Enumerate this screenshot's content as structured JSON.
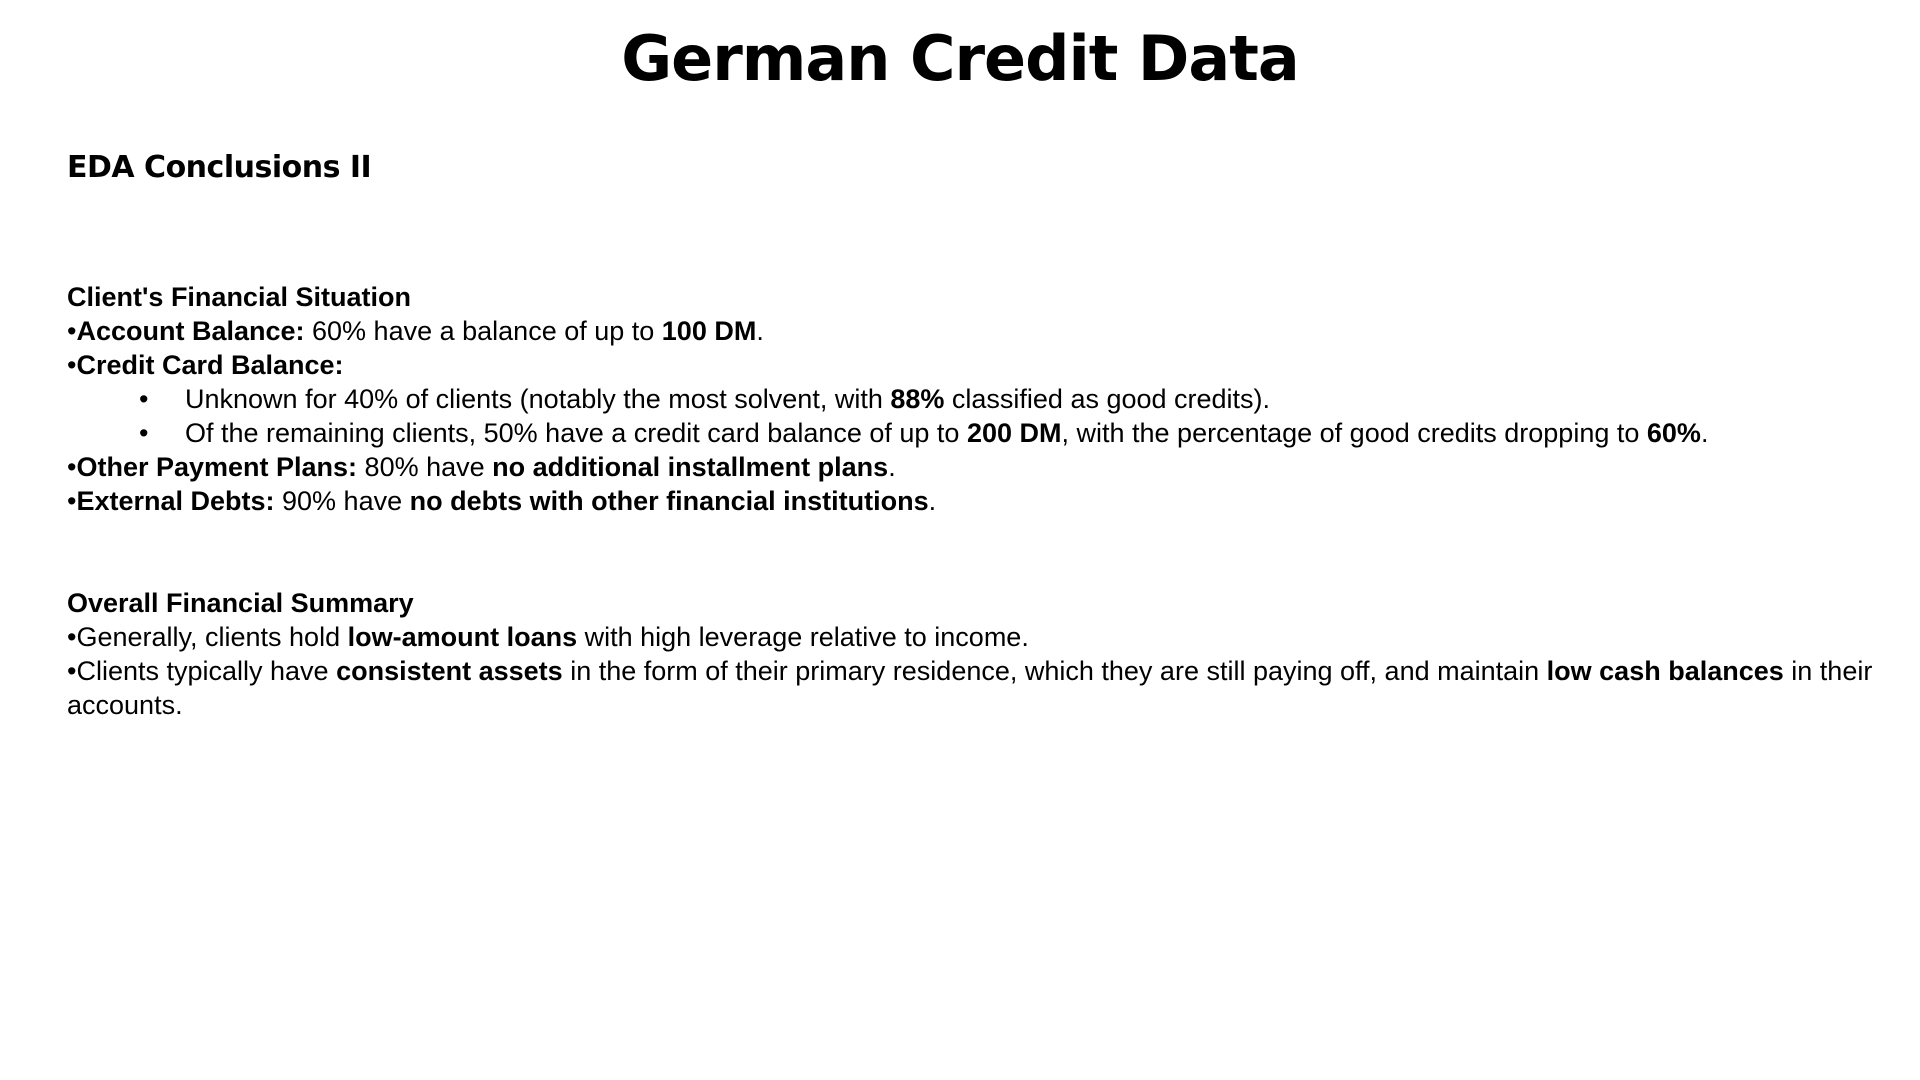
{
  "title": "German Credit Data",
  "subtitle": "EDA Conclusions II",
  "bullet_char": "•",
  "section1": {
    "heading": "Client's Financial Situation",
    "account_balance": {
      "label": "Account Balance:",
      "text1": " 60% have a balance of up to ",
      "bold1": "100 DM",
      "text2": "."
    },
    "credit_card": {
      "label": "Credit Card Balance:",
      "sub1": {
        "text1": "Unknown for 40% of clients (notably the most solvent, with ",
        "bold1": "88%",
        "text2": " classified as good credits)."
      },
      "sub2": {
        "text1": "Of the remaining clients, 50% have a credit card balance of up to ",
        "bold1": "200 DM",
        "text2": ", with the percentage of good credits dropping to ",
        "bold2": "60%",
        "text3": "."
      }
    },
    "other_payment": {
      "label": "Other Payment Plans:",
      "text1": " 80% have ",
      "bold1": "no additional installment plans",
      "text2": "."
    },
    "external_debts": {
      "label": "External Debts:",
      "text1": " 90% have ",
      "bold1": "no debts with other financial institutions",
      "text2": "."
    }
  },
  "section2": {
    "heading": "Overall Financial Summary",
    "item1": {
      "text1": "Generally, clients hold ",
      "bold1": "low-amount loans",
      "text2": " with high leverage relative to income."
    },
    "item2": {
      "text1": "Clients typically have ",
      "bold1": "consistent assets",
      "text2": " in the form of their primary residence, which they are still paying off, and maintain ",
      "bold2": "low cash balances",
      "text3": " in their accounts."
    }
  }
}
